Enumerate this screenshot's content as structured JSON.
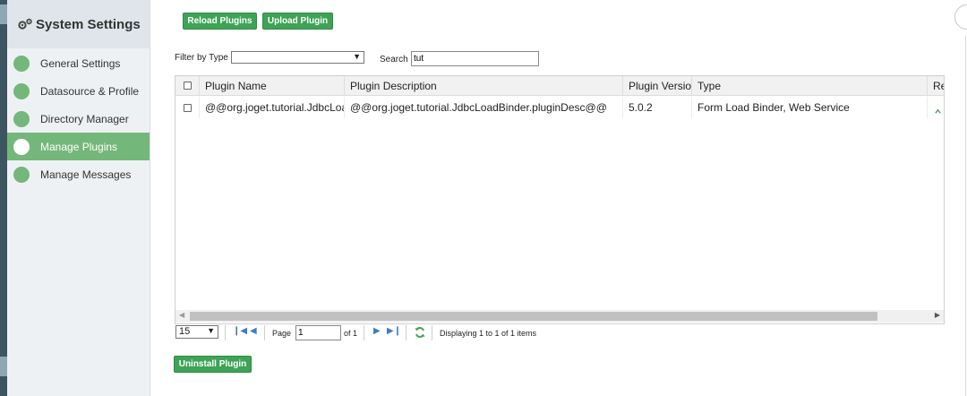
{
  "sidebar": {
    "title": "System Settings",
    "items": [
      {
        "label": "General Settings"
      },
      {
        "label": "Datasource & Profile"
      },
      {
        "label": "Directory Manager"
      },
      {
        "label": "Manage Plugins",
        "active": true
      },
      {
        "label": "Manage Messages"
      }
    ]
  },
  "toolbar": {
    "reload_label": "Reload Plugins",
    "upload_label": "Upload Plugin"
  },
  "filters": {
    "type_label": "Filter by Type",
    "type_value": "",
    "search_label": "Search",
    "search_value": "tut"
  },
  "grid": {
    "columns": [
      "Plugin Name",
      "Plugin Description",
      "Plugin Version",
      "Type",
      "Re"
    ],
    "rows": [
      {
        "name": "@@org.joget.tutorial.JdbcLoadBinder",
        "description": "@@org.joget.tutorial.JdbcLoadBinder.pluginDesc@@",
        "version": "5.0.2",
        "type": "Form Load Binder, Web Service"
      }
    ]
  },
  "pager": {
    "page_size": "15",
    "page_label": "Page",
    "page_value": "1",
    "of_label": "of 1",
    "display_text": "Displaying 1 to 1 of 1 items"
  },
  "actions": {
    "uninstall_label": "Uninstall Plugin"
  },
  "colors": {
    "accent_green": "#3ea356",
    "sidebar_active": "#74b77a",
    "pager_icon_blue": "#3f7dc2"
  }
}
